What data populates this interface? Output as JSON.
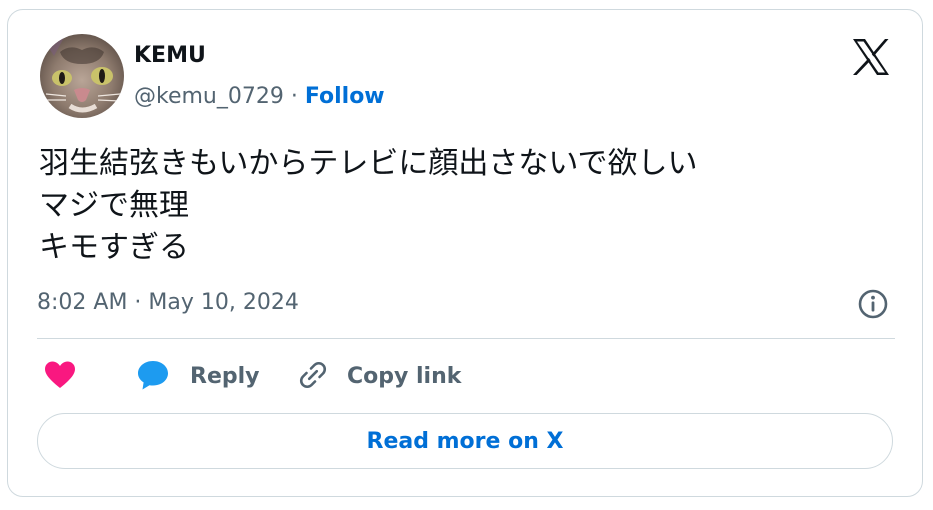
{
  "author": {
    "display_name": "KEMU",
    "handle": "@kemu_0729",
    "separator": "·",
    "follow_label": "Follow"
  },
  "tweet": {
    "lines": [
      "羽生結弦きもいからテレビに顔出さないで欲しい",
      "マジで無理",
      "キモすぎる"
    ],
    "timestamp": "8:02 AM · May 10, 2024"
  },
  "actions": {
    "reply_label": "Reply",
    "copy_link_label": "Copy link"
  },
  "read_more_label": "Read more on X",
  "colors": {
    "link_blue": "#006fd6",
    "heart_pink": "#f91880",
    "reply_blue": "#1d9bf0",
    "secondary_text": "#536471",
    "border": "#cfd9de"
  },
  "icons": {
    "logo": "x-logo-icon",
    "like": "heart-icon",
    "reply": "speech-bubble-icon",
    "copy_link": "link-icon",
    "info": "info-icon"
  }
}
